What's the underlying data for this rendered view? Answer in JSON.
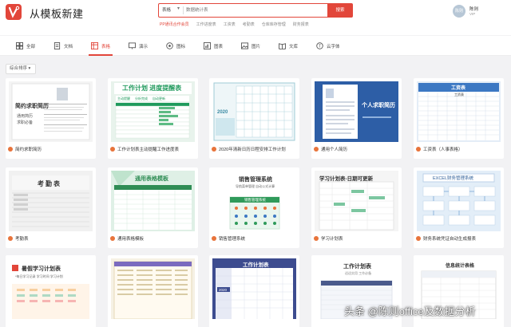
{
  "header": {
    "title": "从模板新建",
    "search": {
      "type": "表格",
      "placeholder": "数据统计表",
      "button": "搜索"
    },
    "hot_links": [
      "PP通讯合作会员",
      "工作进度表",
      "工资表",
      "考勤表",
      "仓库库存管理",
      "财务报表"
    ],
    "user": {
      "avatar": "陈则",
      "name": "陈则",
      "sub": "VIP"
    }
  },
  "categories": [
    {
      "label": "全部",
      "icon": "grid-icon"
    },
    {
      "label": "文档",
      "icon": "doc-icon"
    },
    {
      "label": "表格",
      "icon": "sheet-icon",
      "active": true
    },
    {
      "label": "演示",
      "icon": "slide-icon"
    },
    {
      "label": "图标",
      "icon": "chart-icon"
    },
    {
      "label": "图表",
      "icon": "graph-icon"
    },
    {
      "label": "图片",
      "icon": "image-icon"
    },
    {
      "label": "文库",
      "icon": "library-icon"
    },
    {
      "label": "云字体",
      "icon": "font-icon"
    }
  ],
  "sort": {
    "label": "综合排序"
  },
  "cards": [
    {
      "title": "简约求职简历",
      "thumb_text": "简约求职简历",
      "lines": [
        "通用简历",
        "求职必备"
      ]
    },
    {
      "title": "工作计划表主动提醒工作进度表",
      "thumb_text": "工作计划 进度提醒表",
      "lines": [
        "主动提醒",
        "分析完成",
        "自动更新"
      ]
    },
    {
      "title": "2020年清新日历日程安排工作计划",
      "thumb_text": "2020",
      "lines": []
    },
    {
      "title": "通用个人简历",
      "thumb_text": "个人求职简历",
      "lines": []
    },
    {
      "title": "工资表（人事表格）",
      "thumb_text": "工资表",
      "lines": [
        "工资表"
      ]
    },
    {
      "title": "考勤表",
      "thumb_text": "考勤表",
      "lines": []
    },
    {
      "title": "通用表格模板",
      "thumb_text": "通用表格模板",
      "lines": []
    },
    {
      "title": "销售管理系统",
      "thumb_text": "销售管理系统",
      "lines": [
        "导航菜单管理",
        "自动公式计算",
        "销售管理系统"
      ]
    },
    {
      "title": "学习计划表",
      "thumb_text": "学习计划表-日期可更新",
      "lines": []
    },
    {
      "title": "财务系统凭证自动生成报表",
      "thumb_text": "EXCEL财务管理系统",
      "lines": []
    },
    {
      "title": "",
      "thumb_text": "暑假学习计划表",
      "lines": [
        "*每日学习记录",
        "学习时间",
        "学习计划"
      ]
    },
    {
      "title": "",
      "thumb_text": "",
      "lines": []
    },
    {
      "title": "",
      "thumb_text": "工作计划表",
      "lines": [
        "2020"
      ]
    },
    {
      "title": "",
      "thumb_text": "工作计划表",
      "lines": [
        "适适实用 工作必备"
      ]
    },
    {
      "title": "",
      "thumb_text": "信息统计表格",
      "lines": []
    }
  ],
  "watermark": "头条 @陈则office及数据分析"
}
